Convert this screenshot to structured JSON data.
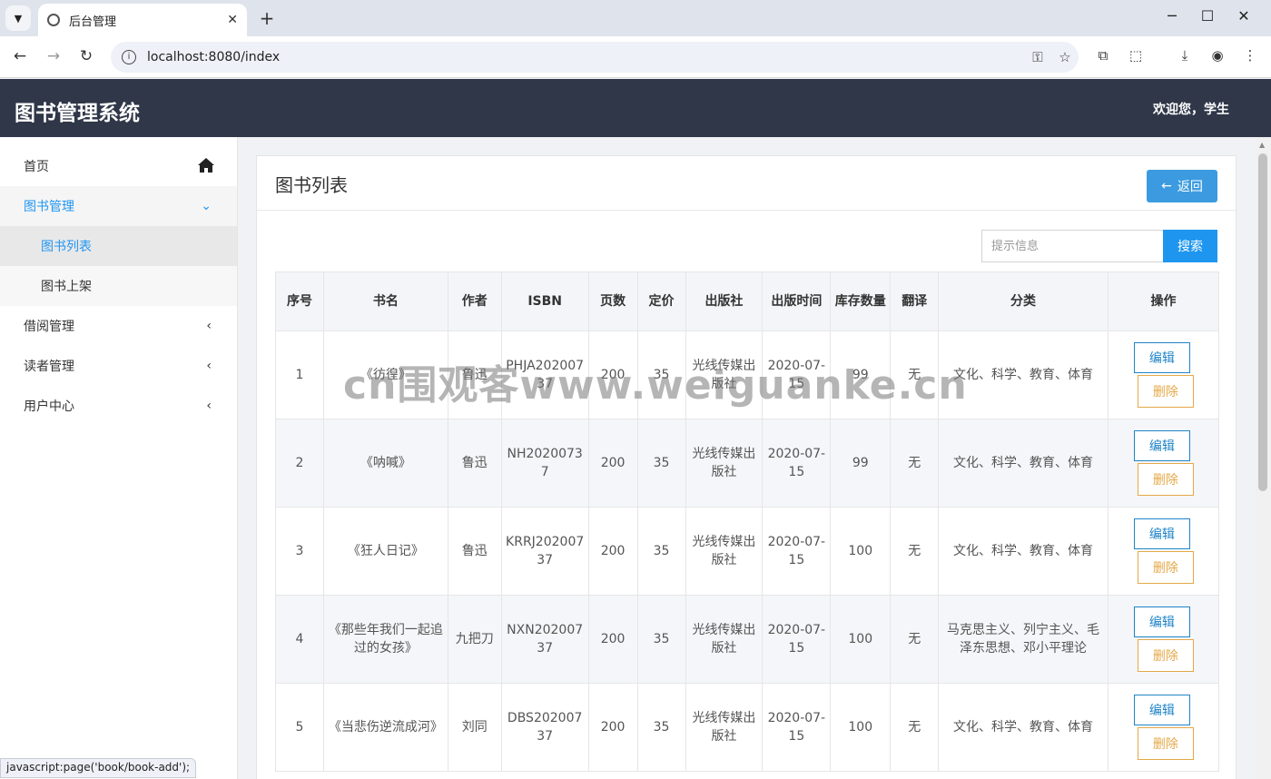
{
  "browser": {
    "tab_title": "后台管理",
    "url": "localhost:8080/index",
    "status_tip": "javascript:page('book/book-add');"
  },
  "header": {
    "title": "图书管理系统",
    "welcome": "欢迎您，学生"
  },
  "sidebar": {
    "home": "首页",
    "book_mgmt": "图书管理",
    "book_list": "图书列表",
    "book_add": "图书上架",
    "borrow_mgmt": "借阅管理",
    "reader_mgmt": "读者管理",
    "user_center": "用户中心"
  },
  "main": {
    "title": "图书列表",
    "back_label": "返回",
    "search_placeholder": "提示信息",
    "search_label": "搜索"
  },
  "table": {
    "headers": [
      "序号",
      "书名",
      "作者",
      "ISBN",
      "页数",
      "定价",
      "出版社",
      "出版时间",
      "库存数量",
      "翻译",
      "分类",
      "操作"
    ],
    "edit_label": "编辑",
    "delete_label": "删除",
    "rows": [
      {
        "no": "1",
        "name": "《彷徨》",
        "author": "鲁迅",
        "isbn": "PHJA20200737",
        "pages": "200",
        "price": "35",
        "publisher": "光线传媒出版社",
        "date": "2020-07-15",
        "stock": "99",
        "translate": "无",
        "category": "文化、科学、教育、体育"
      },
      {
        "no": "2",
        "name": "《呐喊》",
        "author": "鲁迅",
        "isbn": "NH20200737",
        "pages": "200",
        "price": "35",
        "publisher": "光线传媒出版社",
        "date": "2020-07-15",
        "stock": "99",
        "translate": "无",
        "category": "文化、科学、教育、体育"
      },
      {
        "no": "3",
        "name": "《狂人日记》",
        "author": "鲁迅",
        "isbn": "KRRJ20200737",
        "pages": "200",
        "price": "35",
        "publisher": "光线传媒出版社",
        "date": "2020-07-15",
        "stock": "100",
        "translate": "无",
        "category": "文化、科学、教育、体育"
      },
      {
        "no": "4",
        "name": "《那些年我们一起追过的女孩》",
        "author": "九把刀",
        "isbn": "NXN20200737",
        "pages": "200",
        "price": "35",
        "publisher": "光线传媒出版社",
        "date": "2020-07-15",
        "stock": "100",
        "translate": "无",
        "category": "马克思主义、列宁主义、毛泽东思想、邓小平理论"
      },
      {
        "no": "5",
        "name": "《当悲伤逆流成河》",
        "author": "刘同",
        "isbn": "DBS20200737",
        "pages": "200",
        "price": "35",
        "publisher": "光线传媒出版社",
        "date": "2020-07-15",
        "stock": "100",
        "translate": "无",
        "category": "文化、科学、教育、体育"
      }
    ]
  },
  "watermark": "cn围观客www.weiguanke.cn",
  "colors": {
    "header_bg": "#2f3748",
    "accent": "#2196f3",
    "back_btn": "#3c9be0",
    "edit_border": "#1f84c6",
    "delete_border": "#e4a847"
  }
}
